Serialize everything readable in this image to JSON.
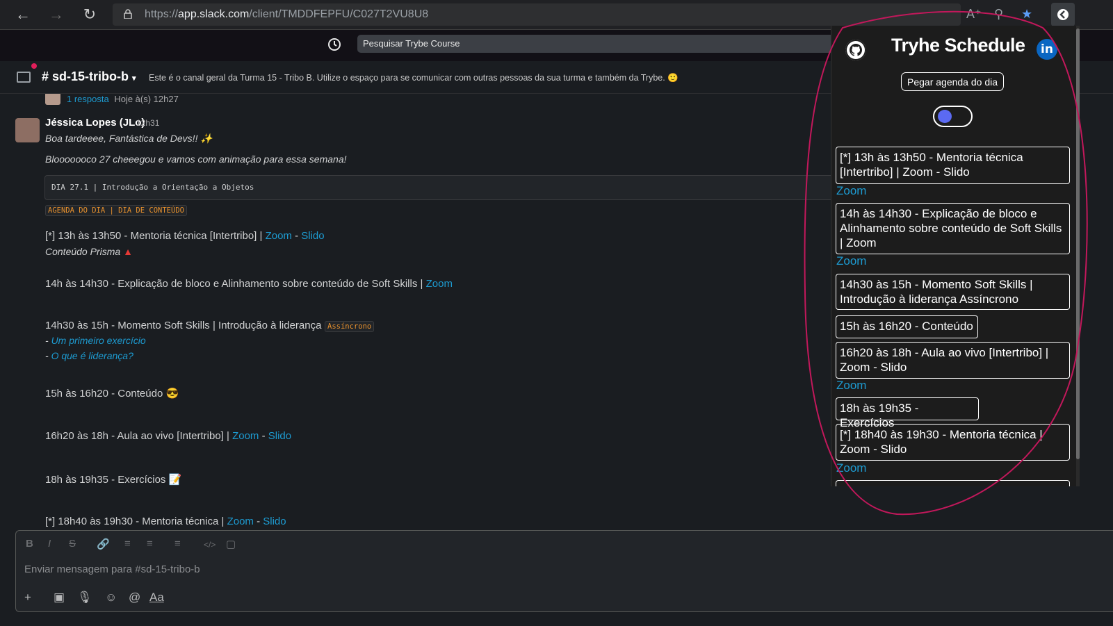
{
  "browser": {
    "url_prefix": "https://",
    "url_host": "app.slack.com",
    "url_path": "/client/TMDDFEPFU/C027T2VU8U8"
  },
  "slack": {
    "search_placeholder": "Pesquisar Trybe Course",
    "channel_name": "# sd-15-tribo-b",
    "channel_description": "Este é o canal geral da Turma 15 - Tribo B. Utilize o espaço para se comunicar com outras pessoas da sua turma e também da Trybe. 🙂",
    "thread_replies": "1 resposta",
    "thread_time": "Hoje à(s) 12h27",
    "author": "Jéssica Lopes (JLo)",
    "time": "12h31",
    "line1": "Boa tardeeee, Fantástica de Devs!!",
    "line2": "Blooooooco 27 cheeegou e vamos com animação para essa semana!",
    "code": "DIA 27.1 | Introdução a Orientação a Objetos",
    "agenda_badge": "AGENDA DO DIA | DIA DE CONTEÚDO",
    "items": {
      "i1_text": "[*] 13h às 13h50 - Mentoria técnica [Intertribo] |",
      "zoom": "Zoom",
      "dash": "-",
      "slido": "Slido",
      "prisma": "Conteúdo Prisma",
      "i2_text": "14h às 14h30 - Explicação de bloco e Alinhamento sobre conteúdo de Soft Skills |",
      "i3_text": "14h30 às 15h - Momento Soft Skills | Introdução à liderança",
      "async_badge": "Assíncrono",
      "i3_link1": "Um primeiro exercício",
      "i3_link2": "O que é liderança?",
      "i4_text": "15h às 16h20 - Conteúdo",
      "i5_text": "16h20 às 18h - Aula ao vivo [Intertribo]  |",
      "i6_text": "18h às 19h35 - Exercícios",
      "i7_text": "[*] 18h40 às 19h30 - Mentoria técnica |"
    },
    "composer_placeholder": "Enviar mensagem para #sd-15-tribo-b",
    "aa": "Aa"
  },
  "popup": {
    "title": "Tryhe Schedule",
    "button": "Pegar agenda do dia",
    "zoom": "Zoom",
    "entries": [
      "[*] 13h às 13h50 - Mentoria técnica [Intertribo] | Zoom - Slido",
      "14h às 14h30 - Explicação de bloco e Alinhamento sobre conteúdo de Soft Skills | Zoom",
      "14h30 às 15h - Momento Soft Skills | Introdução à liderança  Assíncrono",
      "15h às 16h20 - Conteúdo",
      "16h20 às 18h - Aula ao vivo [Intertribo]  | Zoom - Slido",
      "18h às 19h35 - Exercícios",
      "[*] 18h40 às 19h30 - Mentoria técnica | Zoom - Slido"
    ]
  },
  "colors": {
    "link": "#1d9bd1",
    "annotation": "#c2185b",
    "toggle": "#5b6af2",
    "badge_text": "#e8912d"
  }
}
